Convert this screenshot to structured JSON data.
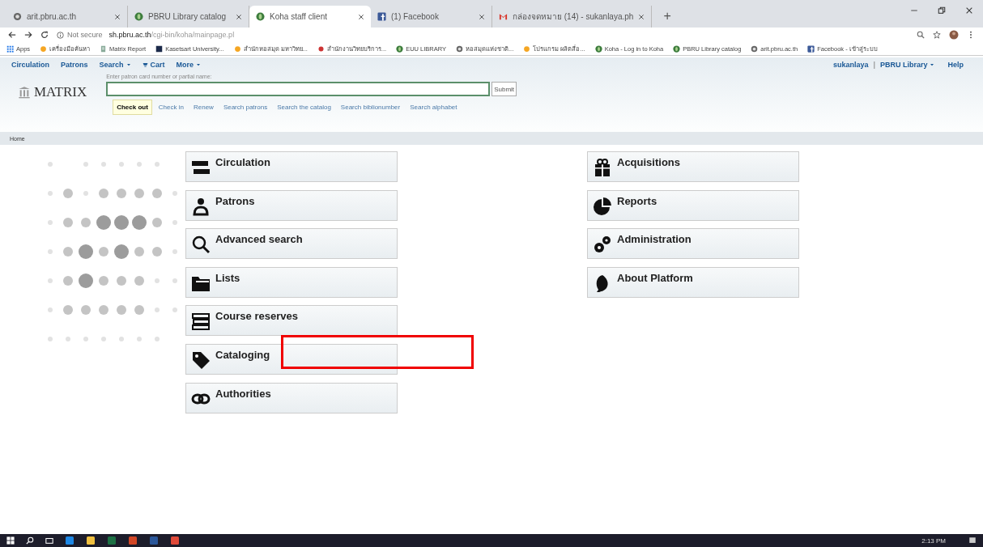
{
  "browser": {
    "tabs": [
      {
        "title": "arit.pbru.ac.th",
        "kind": "globe",
        "selected": false
      },
      {
        "title": "PBRU Library catalog",
        "kind": "koha",
        "selected": false
      },
      {
        "title": "Koha staff client",
        "kind": "koha",
        "selected": true
      },
      {
        "title": "(1) Facebook",
        "kind": "facebook",
        "selected": false
      },
      {
        "title": "กล่องจดหมาย (14) - sukanlaya.ph",
        "kind": "gmail",
        "selected": false
      }
    ],
    "new_tab": "+",
    "address": {
      "security": "Not secure",
      "host": "sh.pbru.ac.th",
      "path": "/cgi-bin/koha/mainpage.pl"
    },
    "bookmarks": [
      {
        "label": "Apps",
        "kind": "apps"
      },
      {
        "label": "เครื่องมือค้นหา",
        "kind": "orange"
      },
      {
        "label": "Matrix Report",
        "kind": "doc"
      },
      {
        "label": "Kasetsart University...",
        "kind": "dark"
      },
      {
        "label": "สำนักหอสมุด มหาวิทย...",
        "kind": "orange"
      },
      {
        "label": "สำนักงานวิทยบริการ...",
        "kind": "red"
      },
      {
        "label": "EUU LIBRARY",
        "kind": "koha"
      },
      {
        "label": "หอสมุดแห่งชาติ...",
        "kind": "globe"
      },
      {
        "label": "โปรแกรม ผลิตสื่อ...",
        "kind": "orange"
      },
      {
        "label": "Koha - Log in to Koha",
        "kind": "koha"
      },
      {
        "label": "PBRU Library catalog",
        "kind": "koha"
      },
      {
        "label": "arit.pbru.ac.th",
        "kind": "globe"
      },
      {
        "label": "Facebook - เข้าสู่ระบบ",
        "kind": "facebook"
      }
    ]
  },
  "koha": {
    "nav": [
      {
        "label": "Circulation",
        "menu": false
      },
      {
        "label": "Patrons",
        "menu": false
      },
      {
        "label": "Search",
        "menu": true
      },
      {
        "label": "Cart",
        "menu": false,
        "kind": "cart"
      },
      {
        "label": "More",
        "menu": true
      }
    ],
    "user": "sukanlaya",
    "user_separator": "|",
    "library": "PBRU Library",
    "help": "Help",
    "logo": "MATRIX",
    "search": {
      "label": "Enter patron card number or partial name:",
      "submit": "Submit"
    },
    "search_tabs": [
      {
        "label": "Check out",
        "selected": true
      },
      {
        "label": "Check in",
        "selected": false
      },
      {
        "label": "Renew",
        "selected": false
      },
      {
        "label": "Search patrons",
        "selected": false
      },
      {
        "label": "Search the catalog",
        "selected": false
      },
      {
        "label": "Search biblionumber",
        "selected": false
      },
      {
        "label": "Search alphabet",
        "selected": false
      }
    ],
    "breadcrumb": "Home",
    "modules_left": [
      {
        "label": "Circulation",
        "kind": "circulation",
        "highlighted": false
      },
      {
        "label": "Patrons",
        "kind": "patrons",
        "highlighted": false
      },
      {
        "label": "Advanced search",
        "kind": "search",
        "highlighted": false
      },
      {
        "label": "Lists",
        "kind": "lists",
        "highlighted": false
      },
      {
        "label": "Course reserves",
        "kind": "books",
        "highlighted": false
      },
      {
        "label": "Cataloging",
        "kind": "tag",
        "highlighted": true
      },
      {
        "label": "Authorities",
        "kind": "link",
        "highlighted": false
      }
    ],
    "modules_right": [
      {
        "label": "Acquisitions",
        "kind": "gift",
        "highlighted": false
      },
      {
        "label": "Reports",
        "kind": "pie",
        "highlighted": false
      },
      {
        "label": "Administration",
        "kind": "gears",
        "highlighted": false
      },
      {
        "label": "About Platform",
        "kind": "leaf",
        "highlighted": false
      }
    ]
  },
  "taskbar": {
    "time": "2:13 PM"
  }
}
